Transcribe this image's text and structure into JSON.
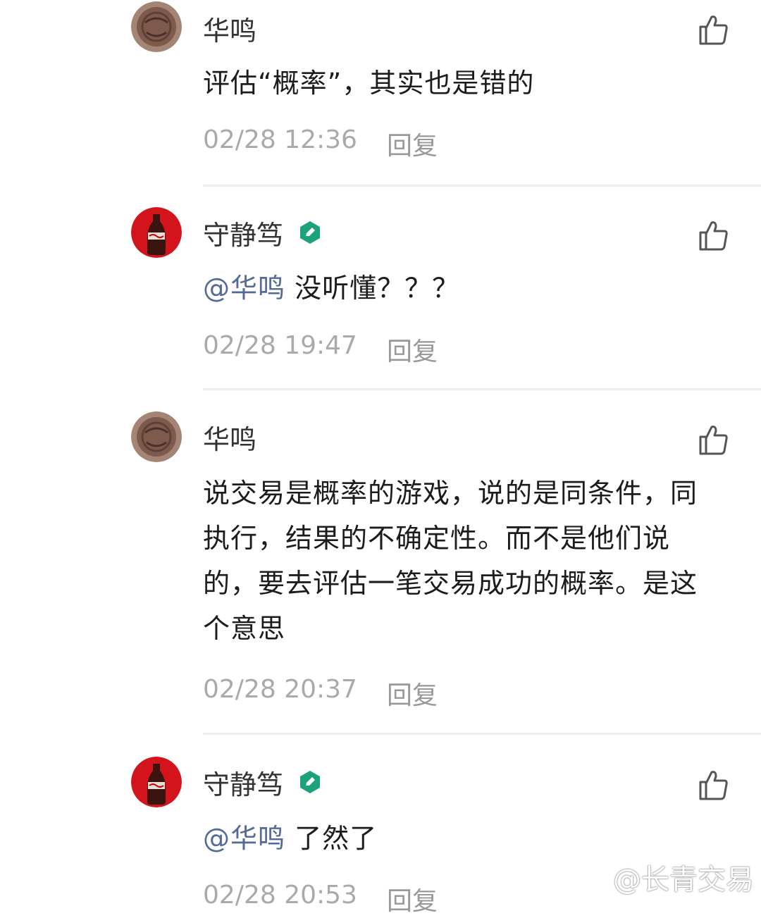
{
  "comments": [
    {
      "author": "华鸣",
      "avatar": "coin-avatar",
      "verified": false,
      "mention": "",
      "text": "评估“概率”，其实也是错的",
      "time": "02/28 12:36",
      "reply_label": "回复"
    },
    {
      "author": "守静笃",
      "avatar": "cola-bottle-avatar",
      "verified": true,
      "mention": "@华鸣",
      "text": " 没听懂？？？",
      "time": "02/28 19:47",
      "reply_label": "回复"
    },
    {
      "author": "华鸣",
      "avatar": "coin-avatar",
      "verified": false,
      "mention": "",
      "text": "说交易是概率的游戏，说的是同条件，同执行，结果的不确定性。而不是他们说的，要去评估一笔交易成功的概率。是这个意思",
      "time": "02/28 20:37",
      "reply_label": "回复"
    },
    {
      "author": "守静笃",
      "avatar": "cola-bottle-avatar",
      "verified": true,
      "mention": "@华鸣",
      "text": " 了然了",
      "time": "02/28 20:53",
      "reply_label": "回复"
    }
  ],
  "watermark": "@长青交易",
  "colors": {
    "mention": "#536b95",
    "badge": "#1aa37a",
    "meta": "#aaaaaa"
  }
}
